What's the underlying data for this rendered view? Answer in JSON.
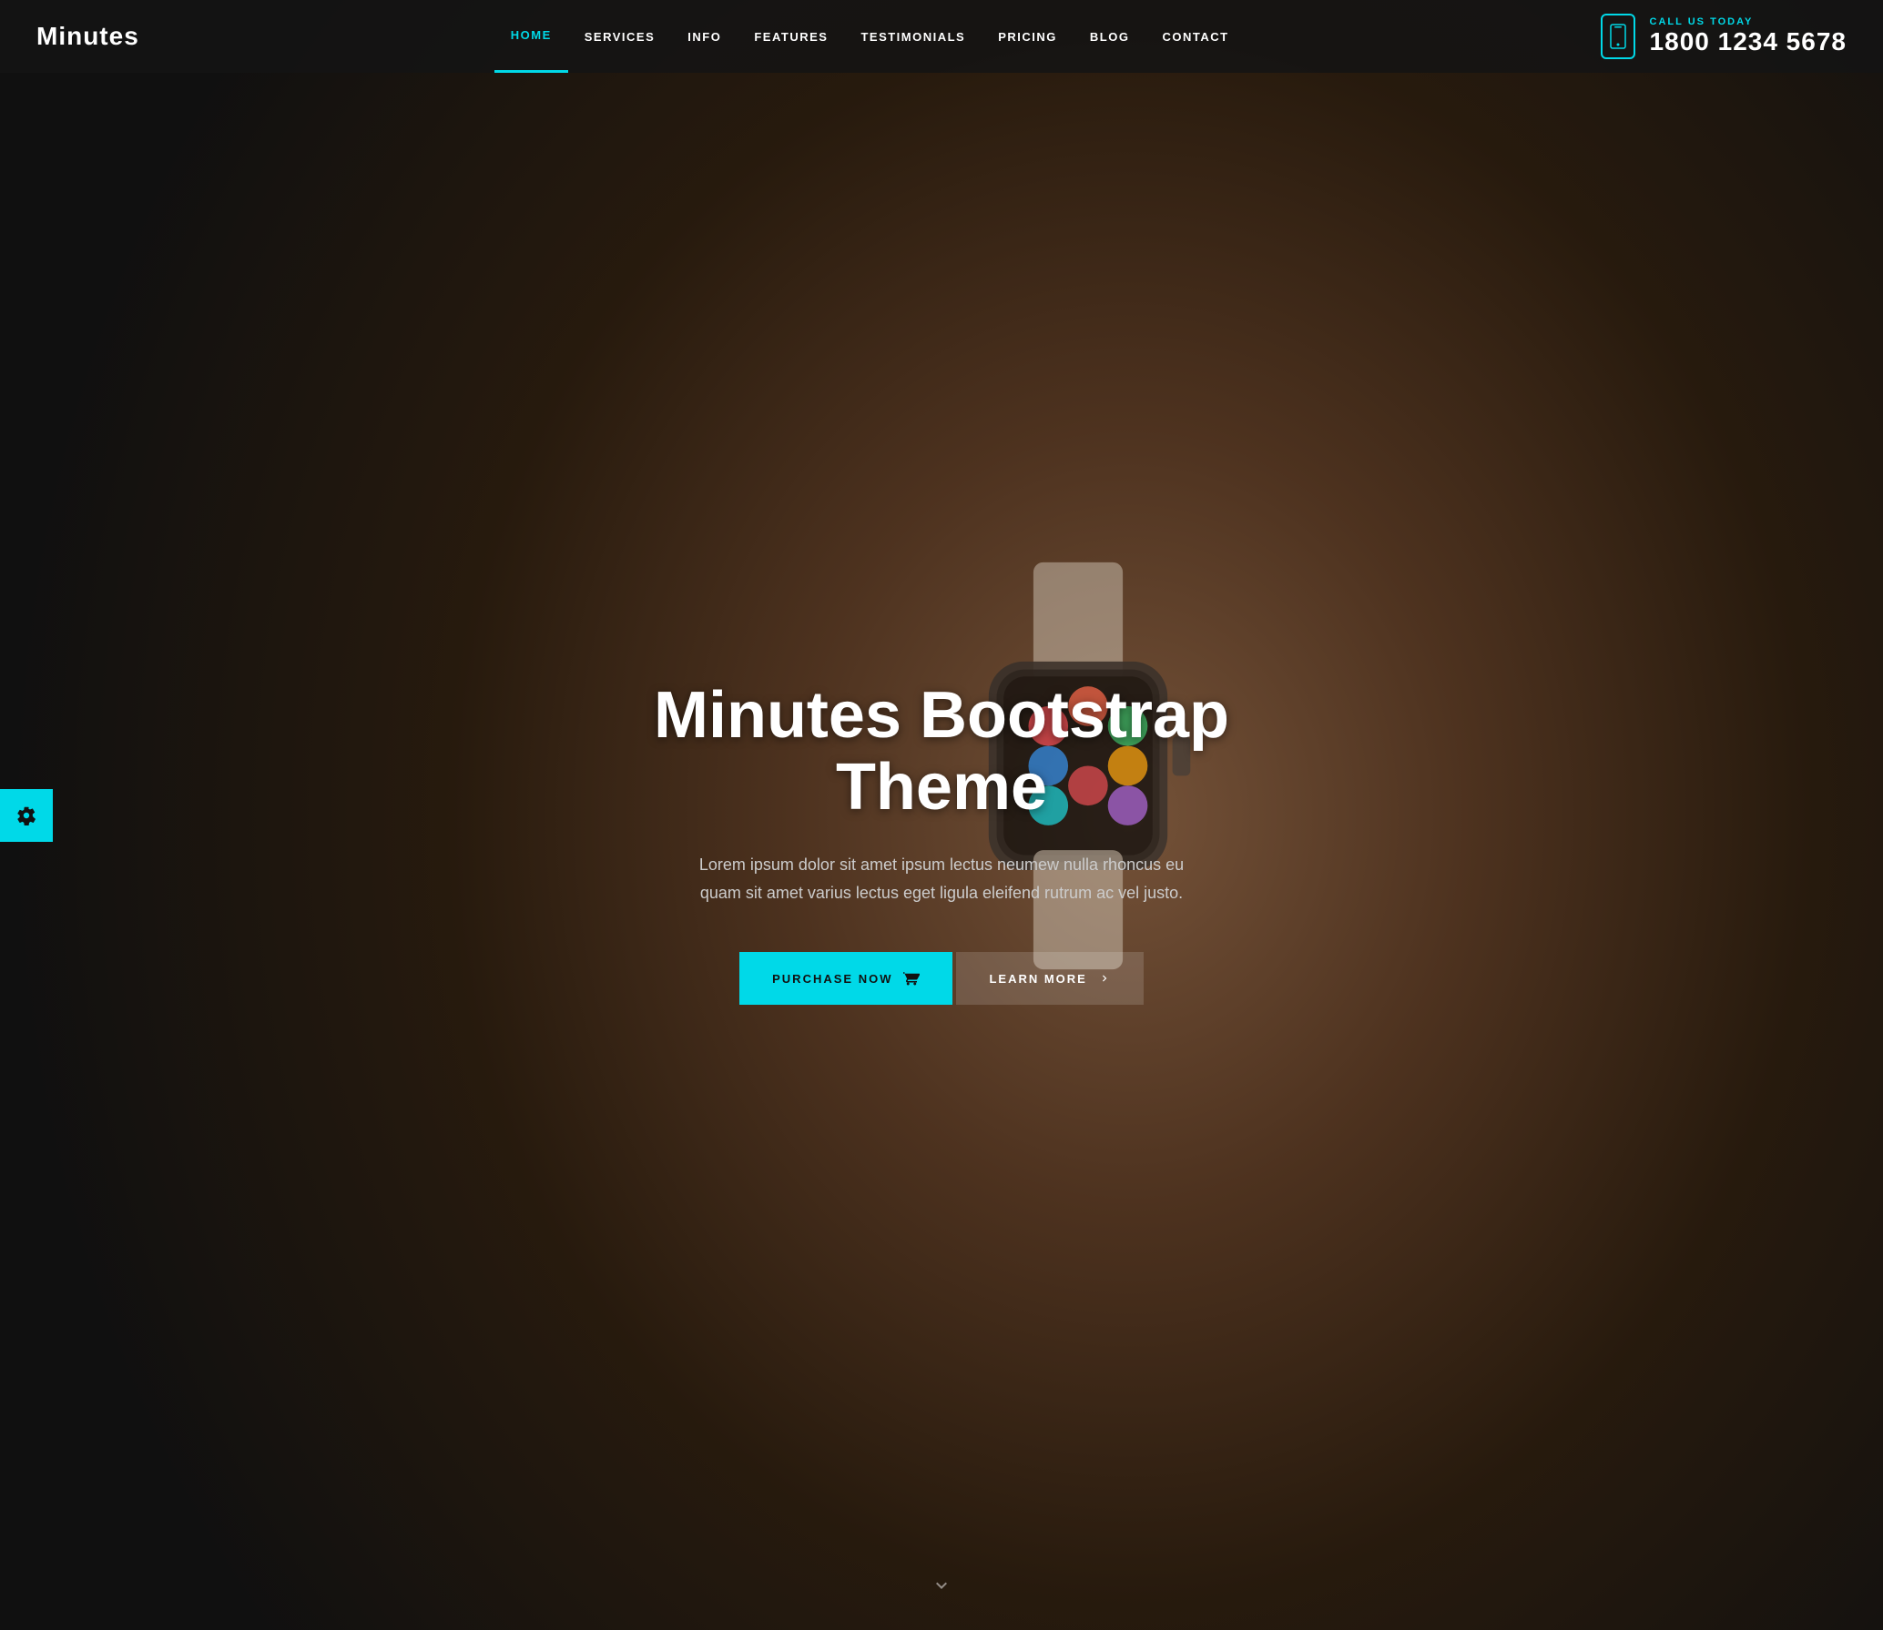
{
  "brand": {
    "logo": "Minutes"
  },
  "header": {
    "nav_items": [
      {
        "label": "HOME",
        "active": true
      },
      {
        "label": "SERVICES",
        "active": false
      },
      {
        "label": "INFO",
        "active": false
      },
      {
        "label": "FEATURES",
        "active": false
      },
      {
        "label": "TESTIMONIALS",
        "active": false
      },
      {
        "label": "PRICING",
        "active": false
      },
      {
        "label": "BLOG",
        "active": false
      },
      {
        "label": "CONTACT",
        "active": false
      }
    ],
    "call_label": "CALL US TODAY",
    "phone": "1800 1234 5678"
  },
  "hero": {
    "title": "Minutes Bootstrap Theme",
    "subtitle": "Lorem ipsum dolor sit amet ipsum lectus neumew nulla rhoncus eu quam sit amet varius lectus eget ligula eleifend rutrum ac vel justo.",
    "btn_purchase": "PURCHASE NOW",
    "btn_learn": "LEARN MORE"
  },
  "settings_btn": {
    "label": "Settings"
  },
  "colors": {
    "accent": "#00d9e8",
    "dark_bg": "#1a1a1a",
    "text_white": "#ffffff",
    "text_gray": "#cccccc"
  }
}
